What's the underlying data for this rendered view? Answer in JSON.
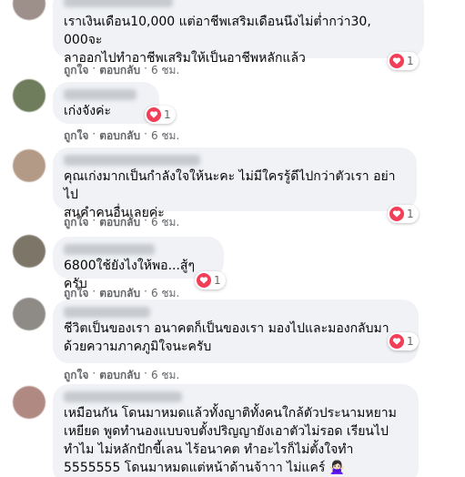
{
  "comments": [
    {
      "text": "เราเงินเดือน10,000 แต่อาชีพเสริมเดือนนึงไม่ต่ำกว่า30, 000จะ\nลาออกไปทำอาชีพเสริมให้เป็นอาชีพหลักแล้ว",
      "like": "ถูกใจ",
      "reply": "ตอบกลับ",
      "time": "6 ชม.",
      "reactions": "1",
      "avatar_color": "#9d8f8a"
    },
    {
      "text": "เก่งจังค่ะ",
      "like": "ถูกใจ",
      "reply": "ตอบกลับ",
      "time": "6 ชม.",
      "reactions": "1",
      "avatar_color": "#6f7d5d"
    },
    {
      "text": "คุณเก่งมากเป็นกำลังใจให้นะคะ ไม่มีใครรู้ดีไปกว่าตัวเรา อย่าไป\nสนคำคนอื่นเลยค่ะ",
      "like": "ถูกใจ",
      "reply": "ตอบกลับ",
      "time": "6 ชม.",
      "reactions": "1",
      "avatar_color": "#b39a86"
    },
    {
      "text": "6800ใช้ยังไงให้พอ...สู้ๆครับ",
      "like": "ถูกใจ",
      "reply": "ตอบกลับ",
      "time": "6 ชม.",
      "reactions": "1",
      "avatar_color": "#7e7569"
    },
    {
      "text": "ชีวิตเป็นของเรา อนาคตก็เป็นของเรา มองไปและมองกลับมา\nด้วยความภาคภูมิใจนะครับ",
      "like": "ถูกใจ",
      "reply": "ตอบกลับ",
      "time": "6 ชม.",
      "reactions": "1",
      "avatar_color": "#8e8b86"
    },
    {
      "text": "เหมือนกัน โดนมาหมดแล้วทั้งญาติทั้งคนใกล้ตัวประนามหยาม\nเหยียด พูดทำนองแบบจบตั้งปริญญายังเอาตัวไม่รอด เรียนไป\nทำไม ไม่หลักปักขี้เลน ไร้อนาคต ทำอะไรก็ไม่ตั้งใจทำ\n5555555 โดนมาหมดแต่หน้าด้านจ้าาา ไม่แคร์ 🙅🏻‍♀️",
      "avatar_color": "#b08a82"
    }
  ],
  "colors": {
    "bubble": "#f0f2f5",
    "heart": "#f33e58",
    "meta": "#65676b",
    "text": "#050505"
  },
  "icons": [
    "heart-icon"
  ]
}
